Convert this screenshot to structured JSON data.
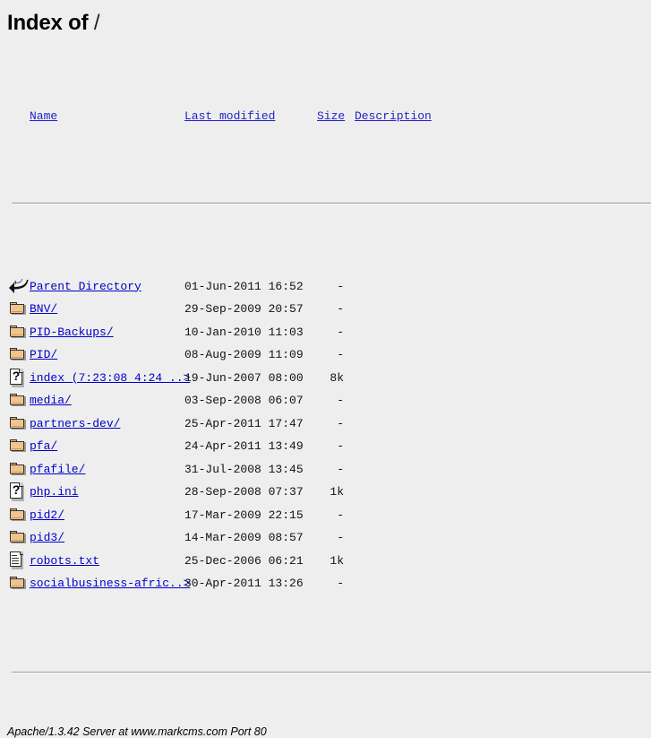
{
  "page": {
    "title_text": "Index of ",
    "title_path": "/",
    "link_color": "#0000cc",
    "background_color": "#eeeeee"
  },
  "columns": {
    "name": "Name",
    "last_modified": "Last modified",
    "size": "Size",
    "description": "Description"
  },
  "entries": [
    {
      "icon": "back-icon",
      "name": "Parent Directory",
      "last_modified": "01-Jun-2011 16:52",
      "size": "-",
      "description": ""
    },
    {
      "icon": "folder-icon",
      "name": "BNV/",
      "last_modified": "29-Sep-2009 20:57",
      "size": "-",
      "description": ""
    },
    {
      "icon": "folder-icon",
      "name": "PID-Backups/",
      "last_modified": "10-Jan-2010 11:03",
      "size": "-",
      "description": ""
    },
    {
      "icon": "folder-icon",
      "name": "PID/",
      "last_modified": "08-Aug-2009 11:09",
      "size": "-",
      "description": ""
    },
    {
      "icon": "unknown-file-icon",
      "name": "index (7:23:08 4:24 ..>",
      "last_modified": "19-Jun-2007 08:00",
      "size": "8k",
      "description": ""
    },
    {
      "icon": "folder-icon",
      "name": "media/",
      "last_modified": "03-Sep-2008 06:07",
      "size": "-",
      "description": ""
    },
    {
      "icon": "folder-icon",
      "name": "partners-dev/",
      "last_modified": "25-Apr-2011 17:47",
      "size": "-",
      "description": ""
    },
    {
      "icon": "folder-icon",
      "name": "pfa/",
      "last_modified": "24-Apr-2011 13:49",
      "size": "-",
      "description": ""
    },
    {
      "icon": "folder-icon",
      "name": "pfafile/",
      "last_modified": "31-Jul-2008 13:45",
      "size": "-",
      "description": ""
    },
    {
      "icon": "unknown-file-icon",
      "name": "php.ini",
      "last_modified": "28-Sep-2008 07:37",
      "size": "1k",
      "description": ""
    },
    {
      "icon": "folder-icon",
      "name": "pid2/",
      "last_modified": "17-Mar-2009 22:15",
      "size": "-",
      "description": ""
    },
    {
      "icon": "folder-icon",
      "name": "pid3/",
      "last_modified": "14-Mar-2009 08:57",
      "size": "-",
      "description": ""
    },
    {
      "icon": "text-file-icon",
      "name": "robots.txt",
      "last_modified": "25-Dec-2006 06:21",
      "size": "1k",
      "description": ""
    },
    {
      "icon": "folder-icon",
      "name": "socialbusiness-afric..>",
      "last_modified": "30-Apr-2011 13:26",
      "size": "-",
      "description": ""
    }
  ],
  "footer": {
    "text": "Apache/1.3.42 Server at www.markcms.com Port 80"
  }
}
